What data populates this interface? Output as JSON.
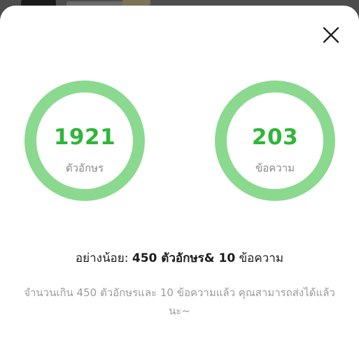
{
  "dialog": {
    "close_icon": "close-icon"
  },
  "stats": [
    {
      "value": "1921",
      "label": "ตัวอักษร"
    },
    {
      "value": "203",
      "label": "ข้อความ"
    }
  ],
  "requirement": {
    "prefix": "อย่างน้อย: ",
    "chars_count": "450",
    "chars_label": " ตัวอักษร",
    "ampersand": "& ",
    "msgs_count": "10",
    "msgs_label": " ข้อความ"
  },
  "hint_text": "จำนวนเกิน 450 ตัวอักษรและ 10 ข้อความแล้ว คุณสามารถส่งได้แล้วนะ~",
  "colors": {
    "ring": "#8ad98f",
    "value": "#2fb639",
    "label": "#8a8a8a",
    "hint": "#9b9b9b"
  }
}
